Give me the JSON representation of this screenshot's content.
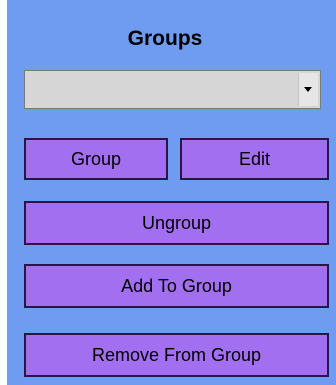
{
  "panel": {
    "title": "Groups",
    "combo": {
      "value": "",
      "icon": "dropdown-arrow-icon"
    },
    "buttons": {
      "group": "Group",
      "edit": "Edit",
      "ungroup": "Ungroup",
      "add_to_group": "Add To Group",
      "remove_from_group": "Remove From Group"
    }
  },
  "colors": {
    "panel_bg": "#6f9cf1",
    "button_bg": "#a36ff1",
    "button_border": "#2a1547",
    "combo_bg": "#d6d6d6"
  }
}
